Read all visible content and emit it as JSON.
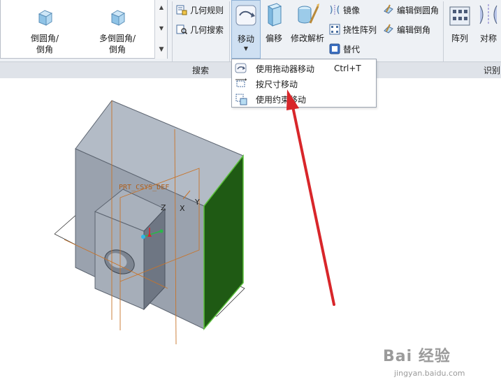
{
  "ribbon": {
    "gallery": {
      "items": [
        {
          "label_line1": "倒圆角/",
          "label_line2": "倒角"
        },
        {
          "label_line1": "多倒圆角/",
          "label_line2": "倒角"
        }
      ]
    },
    "search_group": {
      "label": "搜索",
      "commands": [
        {
          "label": "几何规则"
        },
        {
          "label": "几何搜索"
        }
      ]
    },
    "edit_group": {
      "move_label": "移动",
      "offset_label": "偏移",
      "modify_label": "修改解析",
      "mirror_label": "镜像",
      "flex_pattern_label": "挠性阵列",
      "replace_label": "替代",
      "edit_round_label": "编辑倒圆角",
      "edit_chamfer_label": "编辑倒角"
    },
    "recognize_group": {
      "label": "识别",
      "pattern_label": "阵列",
      "symmetry_label": "对称"
    }
  },
  "move_menu": {
    "items": [
      {
        "label": "使用拖动器移动",
        "shortcut": "Ctrl+T"
      },
      {
        "label": "按尺寸移动",
        "shortcut": ""
      },
      {
        "label": "使用约束移动",
        "shortcut": ""
      }
    ]
  },
  "model": {
    "csys_label": "PRT_CSYS_DEF",
    "axis_z": "Z",
    "axis_x": "X",
    "axis_y": "Y",
    "colors": {
      "body": "#9ea6b2",
      "body_dark": "#6e7683",
      "top": "#b8c0cc",
      "selected_face": "#1f5a14",
      "datum": "#c8742a",
      "arrow": "#d8262a"
    }
  },
  "watermark": {
    "logo": "Bai 经验",
    "url": "jingyan.baidu.com"
  }
}
